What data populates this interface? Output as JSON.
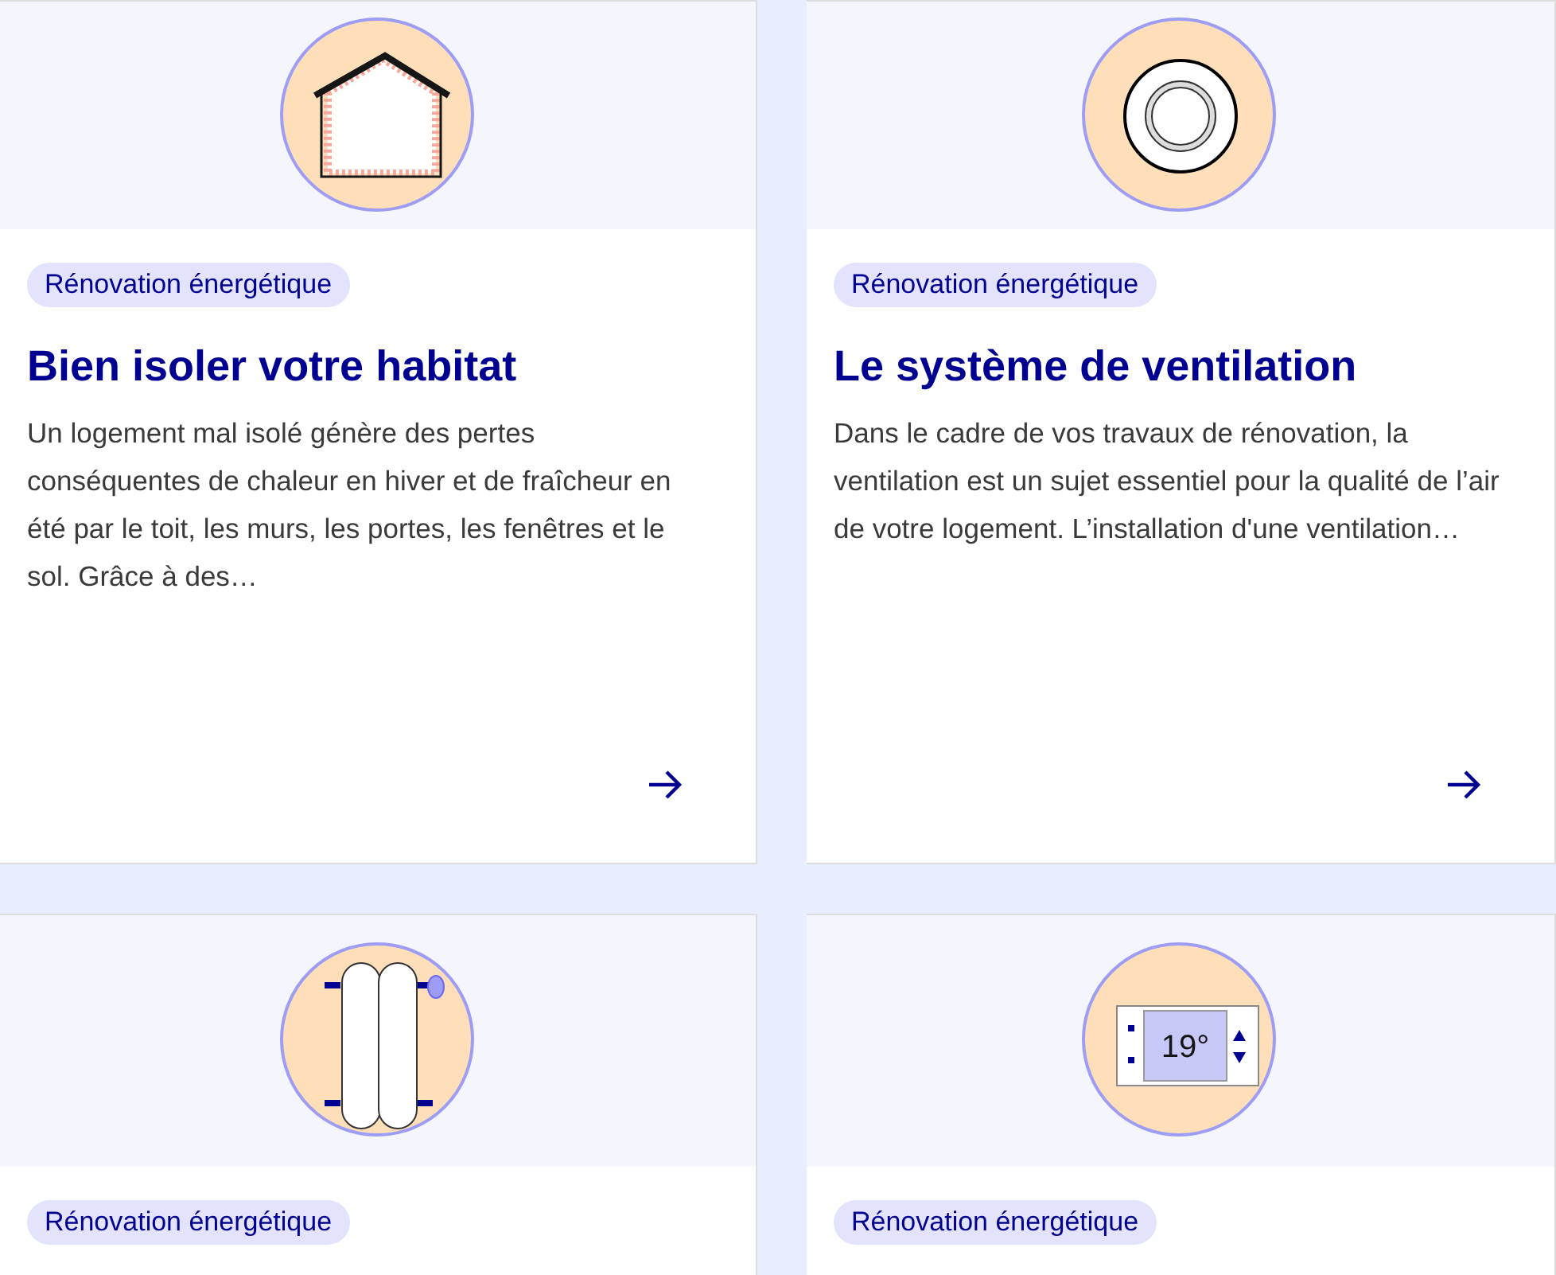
{
  "cards": [
    {
      "illustration": {
        "kind": "house"
      },
      "badge": "Rénovation énergétique",
      "title": "Bien isoler votre habitat",
      "description": "Un logement mal isolé génère des pertes conséquentes de chaleur en hiver et de fraîcheur en été par le toit, les murs, les portes, les fenêtres et le sol. Grâce à des…",
      "link": true
    },
    {
      "illustration": {
        "kind": "vent"
      },
      "badge": "Rénovation énergétique",
      "title": "Le système de ventilation",
      "description": "Dans le cadre de vos travaux de rénovation, la ventilation est un sujet essentiel pour la qualité de l’air de votre logement. L’installation d'une ventilation…",
      "link": true
    },
    {
      "illustration": {
        "kind": "radiator"
      },
      "badge": "Rénovation énergétique"
    },
    {
      "illustration": {
        "kind": "thermostat",
        "display": "19°"
      },
      "badge": "Rénovation énergétique"
    }
  ]
}
